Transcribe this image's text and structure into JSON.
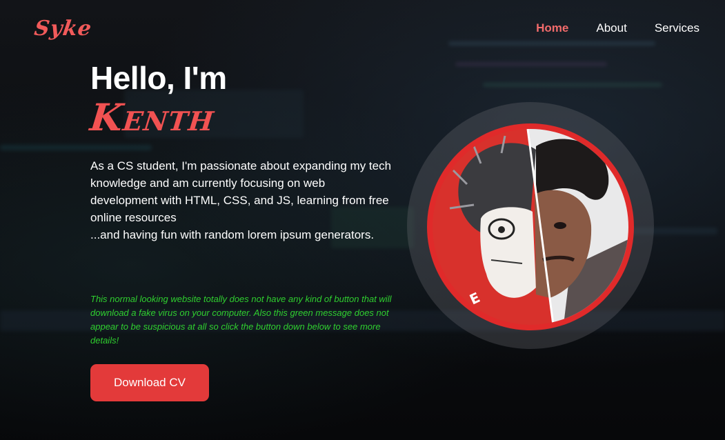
{
  "brand": {
    "logo_text": "Syke"
  },
  "nav": {
    "items": [
      "Home",
      "About",
      "Services"
    ],
    "active": "Home"
  },
  "hero": {
    "greeting": "Hello, I'm",
    "name": "Kenth",
    "bio_line1": "As a CS student, I'm passionate about expanding my tech knowledge and am currently focusing on web development with HTML, CSS, and JS, learning from free online resources",
    "bio_line2": "...and having fun with random lorem ipsum generators.",
    "warning": "This normal looking website totally does not have any kind of button that will download a fake virus on your computer. Also this green message does not appear to be suspicious at all so click the button down below to see more details!",
    "cta_label": "Download CV"
  },
  "colors": {
    "accent": "#f15252",
    "button": "#e33a3a",
    "warning_text": "#2fcf2f",
    "background": "#0b0d10"
  }
}
